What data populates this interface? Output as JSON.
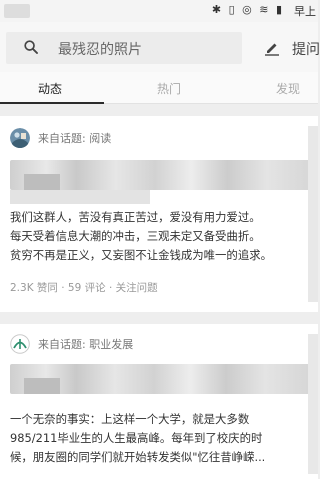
{
  "statusbar": {
    "icons": "✱ ▯ ◎ ≋ ▮",
    "clock": "早上"
  },
  "search": {
    "placeholder": "最残忍的照片",
    "ask_label": "提问"
  },
  "tabs": [
    {
      "label": "动态"
    },
    {
      "label": "热门"
    },
    {
      "label": "发现"
    }
  ],
  "feed": [
    {
      "topic": "来自话题: 阅读",
      "excerpt": [
        "我们这群人，苦没有真正苦过，爱没有用力爱过。",
        "每天受着信息大潮的冲击，三观未定又备受曲折。",
        "贫穷不再是正义，又妄图不让金钱成为唯一的追求。"
      ],
      "meta": "2.3K 赞同 · 59 评论 · 关注问题"
    },
    {
      "topic": "来自话题: 职业发展",
      "excerpt": [
        "一个无奈的事实：上这样一个大学，就是大多数",
        "985/211毕业生的人生最高峰。每年到了校庆的时",
        "候，朋友圈的同学们就开始转发类似\"忆往昔峥嵘..."
      ]
    }
  ]
}
